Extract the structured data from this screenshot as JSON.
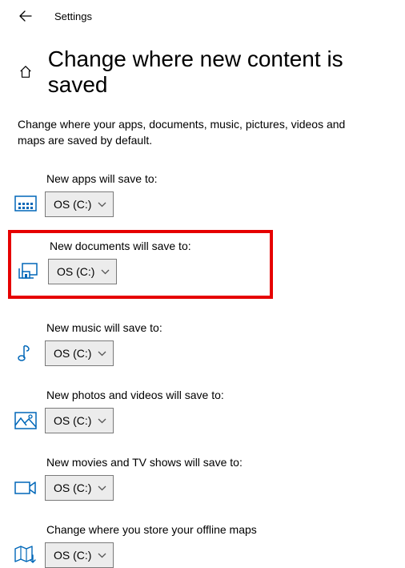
{
  "topbar": {
    "app_title": "Settings"
  },
  "page": {
    "heading": "Change where new content is saved",
    "description": "Change where your apps, documents, music, pictures, videos and maps are saved by default."
  },
  "sections": {
    "apps": {
      "label": "New apps will save to:",
      "value": "OS (C:)"
    },
    "documents": {
      "label": "New documents will save to:",
      "value": "OS (C:)"
    },
    "music": {
      "label": "New music will save to:",
      "value": "OS (C:)"
    },
    "photos": {
      "label": "New photos and videos will save to:",
      "value": "OS (C:)"
    },
    "movies": {
      "label": "New movies and TV shows will save to:",
      "value": "OS (C:)"
    },
    "maps": {
      "label": "Change where you store your offline maps",
      "value": "OS (C:)"
    }
  }
}
